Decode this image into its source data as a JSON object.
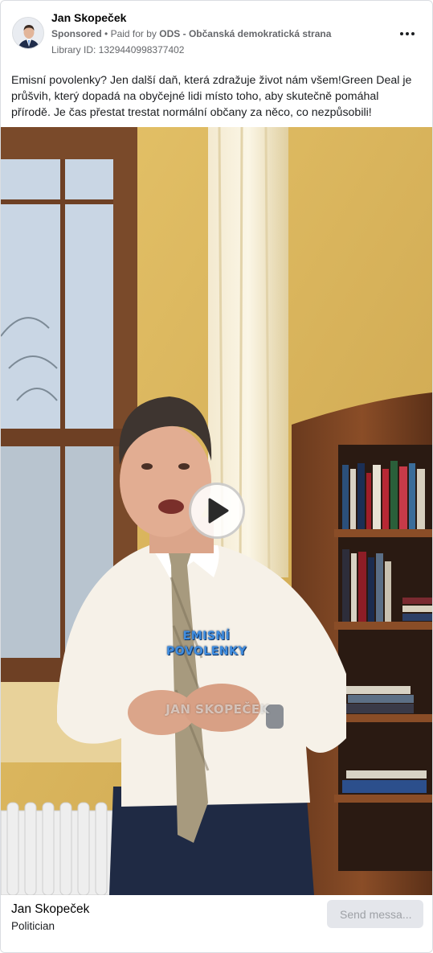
{
  "ad": {
    "page_name": "Jan Skopeček",
    "sponsored_label": "Sponsored",
    "paid_for_prefix": "Paid for by",
    "payer": "ODS - Občanská demokratická strana",
    "library_id": "Library ID: 1329440998377402",
    "more_icon": "more-horizontal-icon",
    "post_text": "Emisní povolenky? Jen další daň, která zdražuje život nám všem!Green Deal je průšvih, který dopadá na obyčejné lidi místo toho, aby skutečně pomáhal přírodě. Je čas přestat trestat normální občany za něco, co nezpůsobili!"
  },
  "video": {
    "caption_line_1": "EMISNÍ",
    "caption_line_2": "POVOLENKY",
    "watermark": "JAN SKOPEČEK",
    "play_icon": "play-icon"
  },
  "footer": {
    "name": "Jan Skopeček",
    "category": "Politician",
    "send_label": "Send messa..."
  },
  "colors": {
    "caption_blue": "#3f8de0",
    "wall": "#d9b45a",
    "button_bg": "#e4e6eb"
  }
}
